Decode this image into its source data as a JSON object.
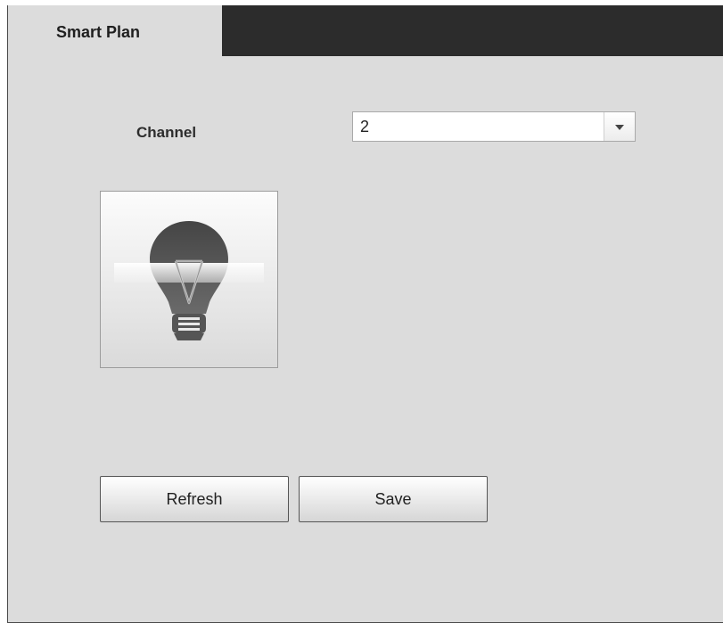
{
  "tabs": [
    {
      "label": "Smart Plan",
      "active": true
    }
  ],
  "channel": {
    "label": "Channel",
    "value": "2"
  },
  "buttons": {
    "refresh": "Refresh",
    "save": "Save"
  },
  "icons": {
    "plan_button": "lightbulb-icon",
    "dropdown": "chevron-down-icon"
  },
  "colors": {
    "panel_bg": "#dcdcdc",
    "tabbar_bg": "#2c2c2c"
  }
}
